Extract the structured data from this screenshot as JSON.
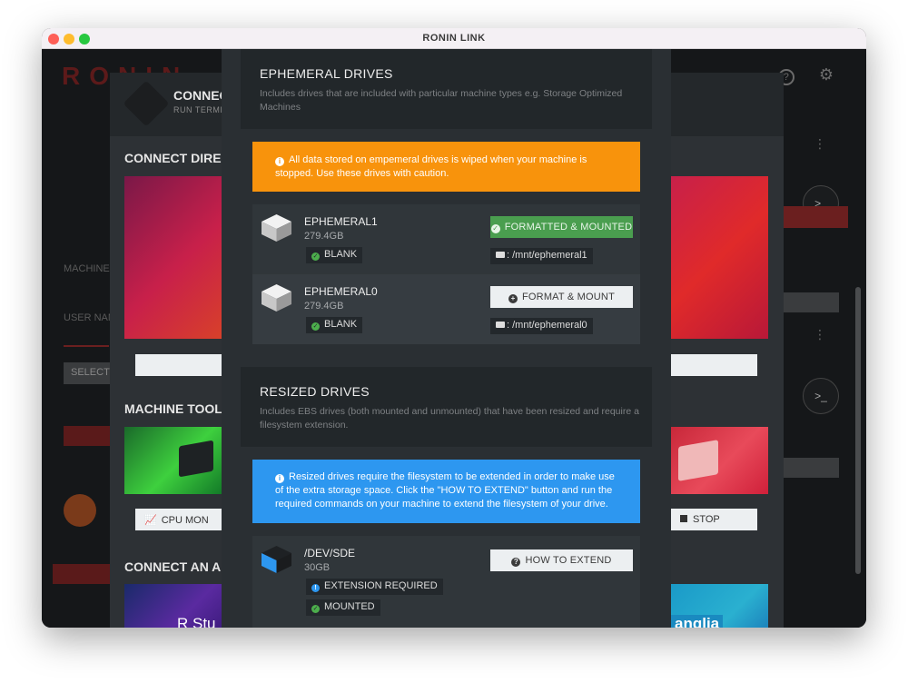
{
  "window": {
    "title": "RONIN LINK"
  },
  "background_app": {
    "logo": "RONIN",
    "machine_label": "MACHINE",
    "user_label": "USER NAM",
    "select_label": "SELECT"
  },
  "middle_modal": {
    "title": "CONNEC",
    "subtitle": "RUN TERMI",
    "sections": [
      "CONNECT DIRECT",
      "MACHINE TOOLS",
      "CONNECT AN AP"
    ],
    "cpu_button": "CPU MON",
    "stop_button": "STOP",
    "rstudio_label": "R Stu",
    "ganglia_label": "anglia"
  },
  "ephemeral": {
    "title": "EPHEMERAL DRIVES",
    "description": "Includes drives that are included with particular machine types e.g. Storage Optimized Machines",
    "alert": "All data stored on empemeral drives is wiped when your machine is stopped. Use these drives with caution.",
    "drives": [
      {
        "name": "EPHEMERAL1",
        "size": "279.4GB",
        "status": "BLANK",
        "action": "FORMATTED & MOUNTED",
        "mount": ": /mnt/ephemeral1"
      },
      {
        "name": "EPHEMERAL0",
        "size": "279.4GB",
        "status": "BLANK",
        "action": "FORMAT & MOUNT",
        "mount": ": /mnt/ephemeral0"
      }
    ]
  },
  "resized": {
    "title": "RESIZED DRIVES",
    "description": "Includes EBS drives (both mounted and unmounted) that have been resized and require a filesystem extension.",
    "alert": "Resized drives require the filesystem to be extended in order to make use of the extra storage space. Click the \"HOW TO EXTEND\" button and run the required commands on your machine to extend the filesystem of your drive.",
    "drives": [
      {
        "name": "/DEV/SDE",
        "size": "30GB",
        "tag1": "EXTENSION REQUIRED",
        "tag2": "MOUNTED",
        "action": "HOW TO EXTEND"
      }
    ]
  },
  "colors": {
    "orange_alert": "#f8930c",
    "blue_alert": "#2d97f0",
    "green_button": "#4a9e4f",
    "ok_green": "#4cae4c"
  }
}
